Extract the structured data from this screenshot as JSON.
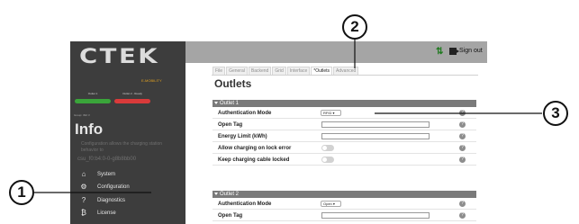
{
  "sidebar": {
    "logo": "CTEK",
    "logo_sub": "E-MOBILITY",
    "outlets": [
      {
        "name": "Outlet 1",
        "color": "#3aa53a"
      },
      {
        "name": "Outlet 2 - Ready",
        "color": "#d93a3a"
      }
    ],
    "small_id": "Group: 392 V",
    "info_title": "Info",
    "info_desc": "Configuration allows the charging station behavior to",
    "host": "csu_f0:b4:0-0-g8b8bb00",
    "nav": [
      {
        "icon": "home-icon",
        "glyph": "⌂",
        "label": "System"
      },
      {
        "icon": "gear-icon",
        "glyph": "⚙",
        "label": "Configuration"
      },
      {
        "icon": "question-icon",
        "glyph": "?",
        "label": "Diagnostics"
      },
      {
        "icon": "license-icon",
        "glyph": "₿",
        "label": "License"
      }
    ]
  },
  "topbar": {
    "arrows": "⇅",
    "signout_label": "Sign out"
  },
  "tabs": [
    {
      "label": "File",
      "active": false
    },
    {
      "label": "General",
      "active": false
    },
    {
      "label": "Backend",
      "active": false
    },
    {
      "label": "Grid",
      "active": false
    },
    {
      "label": "Interface",
      "active": false
    },
    {
      "label": "*Outlets",
      "active": true
    },
    {
      "label": "Advanced",
      "active": false
    }
  ],
  "page_title": "Outlets",
  "sections": [
    {
      "title": "Outlet 1",
      "rows": [
        {
          "label": "Authentication Mode",
          "control": "select",
          "value": "RFID"
        },
        {
          "label": "Open Tag",
          "control": "text",
          "value": ""
        },
        {
          "label": "Energy Limit (kWh)",
          "control": "text",
          "value": ""
        },
        {
          "label": "Allow charging on lock error",
          "control": "toggle",
          "value": "off"
        },
        {
          "label": "Keep charging cable locked",
          "control": "toggle",
          "value": "off"
        }
      ]
    },
    {
      "title": "Outlet 2",
      "rows": [
        {
          "label": "Authentication Mode",
          "control": "select",
          "value": "Open"
        },
        {
          "label": "Open Tag",
          "control": "text",
          "value": ""
        }
      ]
    }
  ],
  "callouts": [
    "1",
    "2",
    "3"
  ]
}
